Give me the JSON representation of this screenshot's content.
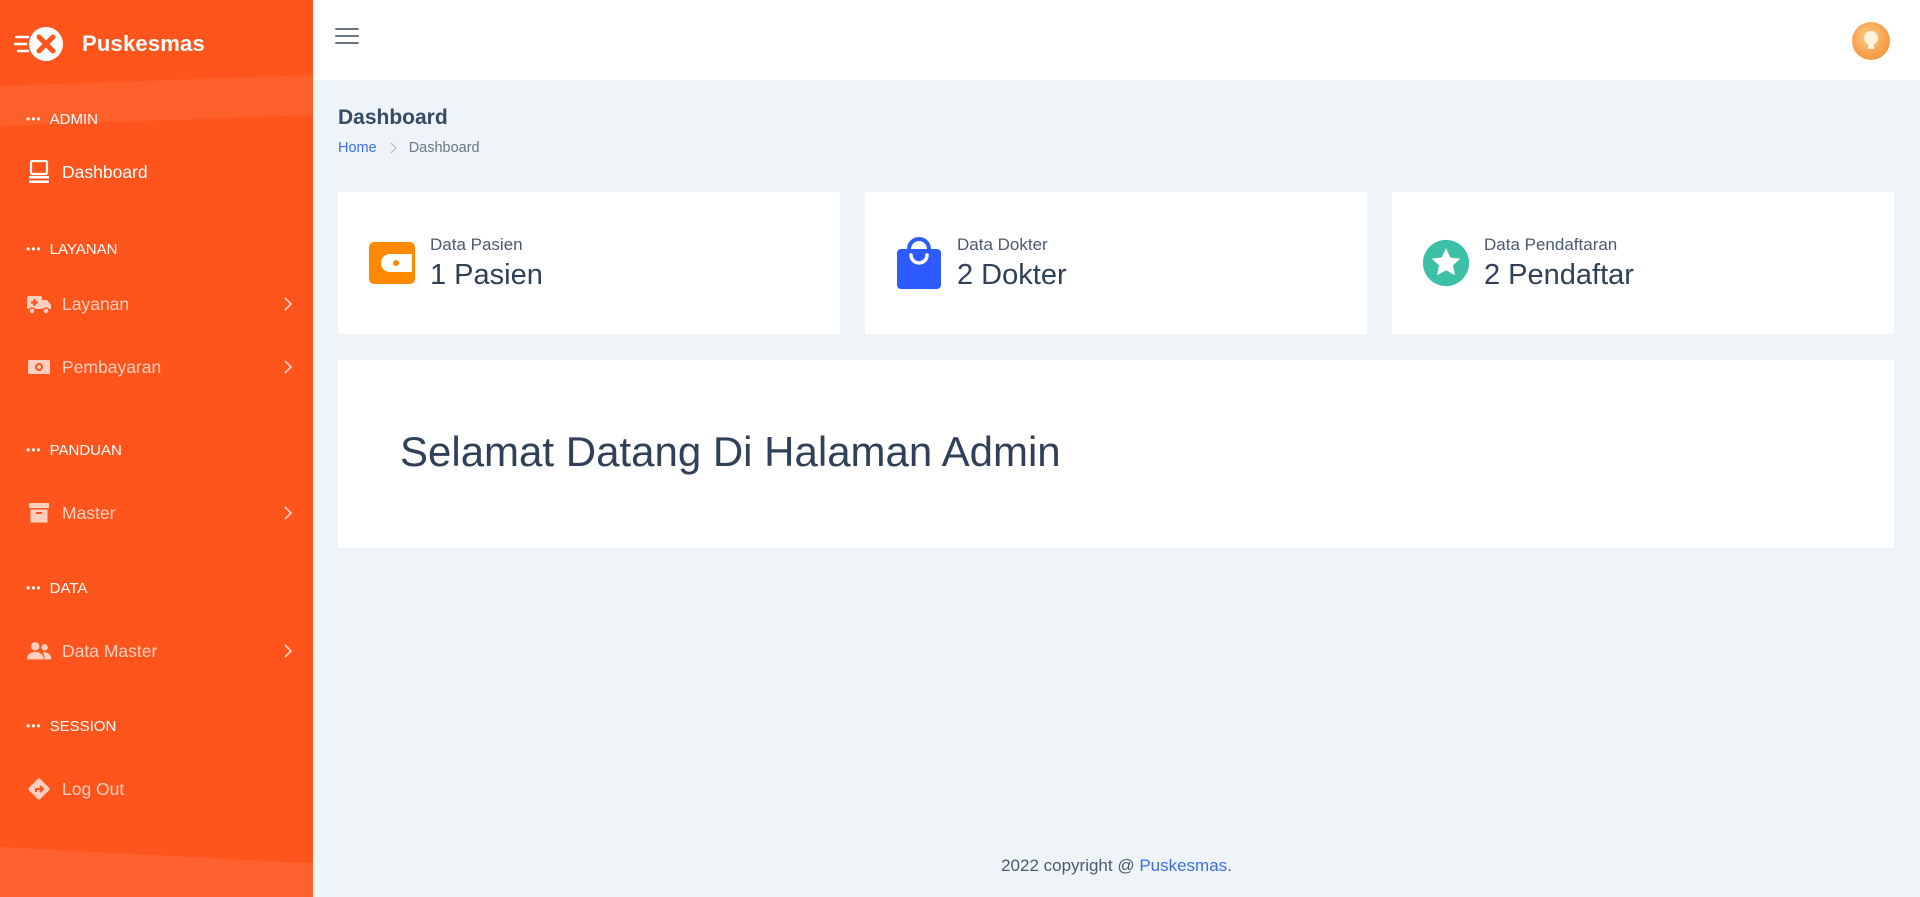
{
  "brand": {
    "name": "Puskesmas"
  },
  "sidebar": {
    "sections": [
      {
        "label": "ADMIN"
      },
      {
        "label": "LAYANAN"
      },
      {
        "label": "PANDUAN"
      },
      {
        "label": "DATA"
      },
      {
        "label": "SESSION"
      }
    ],
    "items": [
      {
        "label": "Dashboard",
        "icon": "laptop-icon",
        "active": true
      },
      {
        "label": "Layanan",
        "icon": "ambulance-icon"
      },
      {
        "label": "Pembayaran",
        "icon": "money-icon"
      },
      {
        "label": "Master",
        "icon": "archive-icon"
      },
      {
        "label": "Data Master",
        "icon": "users-icon"
      },
      {
        "label": "Log Out",
        "icon": "logout-icon"
      }
    ]
  },
  "header": {
    "avatar_icon": "bulb-icon"
  },
  "page": {
    "title": "Dashboard",
    "breadcrumb": {
      "home": "Home",
      "current": "Dashboard"
    }
  },
  "cards": [
    {
      "label": "Data Pasien",
      "value": "1 Pasien",
      "icon": "wallet-icon",
      "color": "#ff8a00"
    },
    {
      "label": "Data Dokter",
      "value": "2 Dokter",
      "icon": "shopping-bag-icon",
      "color": "#2e5bff"
    },
    {
      "label": "Data Pendaftaran",
      "value": "2 Pendaftar",
      "icon": "star-icon",
      "color": "#3cc0a8"
    }
  ],
  "welcome": {
    "title": "Selamat Datang Di Halaman Admin"
  },
  "footer": {
    "text": "2022 copyright @ ",
    "link": "Puskesmas",
    "end": "."
  },
  "colors": {
    "sidebar": "#ff551d",
    "accent": "#3b6fe6",
    "background": "#eef4f8"
  }
}
